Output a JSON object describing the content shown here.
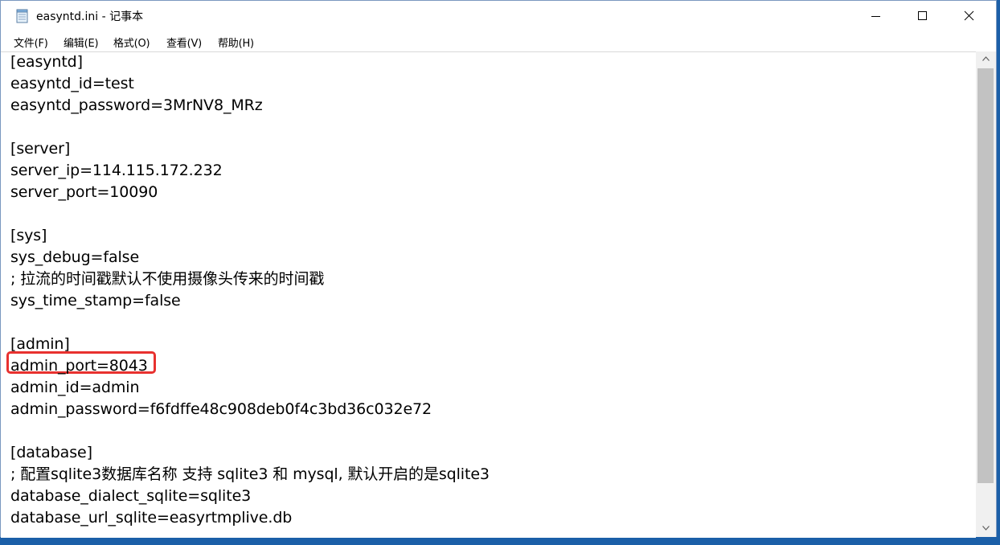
{
  "window": {
    "title": "easyntd.ini - 记事本"
  },
  "menu": {
    "items": [
      "文件(F)",
      "编辑(E)",
      "格式(O)",
      "查看(V)",
      "帮助(H)"
    ]
  },
  "editor": {
    "lines": [
      "[easyntd]",
      "easyntd_id=test",
      "easyntd_password=3MrNV8_MRz",
      "",
      "[server]",
      "server_ip=114.115.172.232",
      "server_port=10090",
      "",
      "[sys]",
      "sys_debug=false",
      "; 拉流的时间戳默认不使用摄像头传来的时间戳",
      "sys_time_stamp=false",
      "",
      "[admin]",
      "admin_port=8043",
      "admin_id=admin",
      "admin_password=f6fdffe48c908deb0f4c3bd36c032e72",
      "",
      "[database]",
      "; 配置sqlite3数据库名称 支持 sqlite3 和 mysql, 默认开启的是sqlite3",
      "database_dialect_sqlite=sqlite3",
      "database_url_sqlite=easyrtmplive.db"
    ]
  },
  "colors": {
    "highlight": "#e8312f",
    "desktop": "#1b5fa8"
  },
  "icons": {
    "app": "notepad-icon",
    "minimize": "minimize-icon",
    "maximize": "maximize-icon",
    "close": "close-icon"
  }
}
